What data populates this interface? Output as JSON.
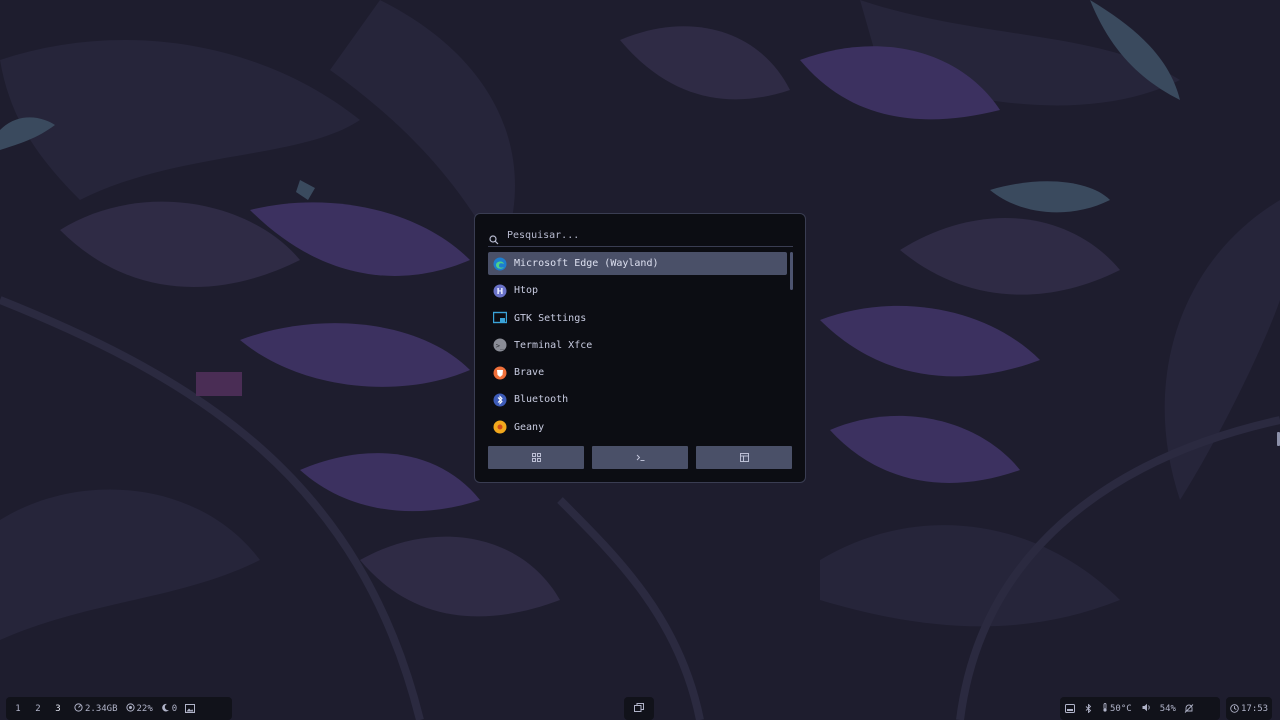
{
  "launcher": {
    "search_placeholder": "Pesquisar...",
    "apps": [
      {
        "label": "Microsoft Edge (Wayland)",
        "icon": "edge-icon",
        "selected": true
      },
      {
        "label": "Htop",
        "icon": "htop-icon"
      },
      {
        "label": "GTK Settings",
        "icon": "gtk-settings-icon"
      },
      {
        "label": "Terminal Xfce",
        "icon": "terminal-icon"
      },
      {
        "label": "Brave",
        "icon": "brave-icon"
      },
      {
        "label": "Bluetooth",
        "icon": "bluetooth-icon"
      },
      {
        "label": "Geany",
        "icon": "geany-icon"
      }
    ],
    "modes": [
      {
        "icon": "grid-icon"
      },
      {
        "icon": "terminal-prompt-icon"
      },
      {
        "icon": "window-icon"
      }
    ]
  },
  "taskbar": {
    "workspaces": [
      "1",
      "2",
      "3"
    ],
    "active_workspace": "3",
    "memory": "2.34GB",
    "cpu": "22%",
    "updates": "0",
    "temperature": "50°C",
    "volume": "54%",
    "clock": "17:53"
  },
  "colors": {
    "launcher_bg": "#0c0d13",
    "selection": "#4a5068",
    "border": "#3a3d52",
    "text": "#c8cbe0"
  }
}
